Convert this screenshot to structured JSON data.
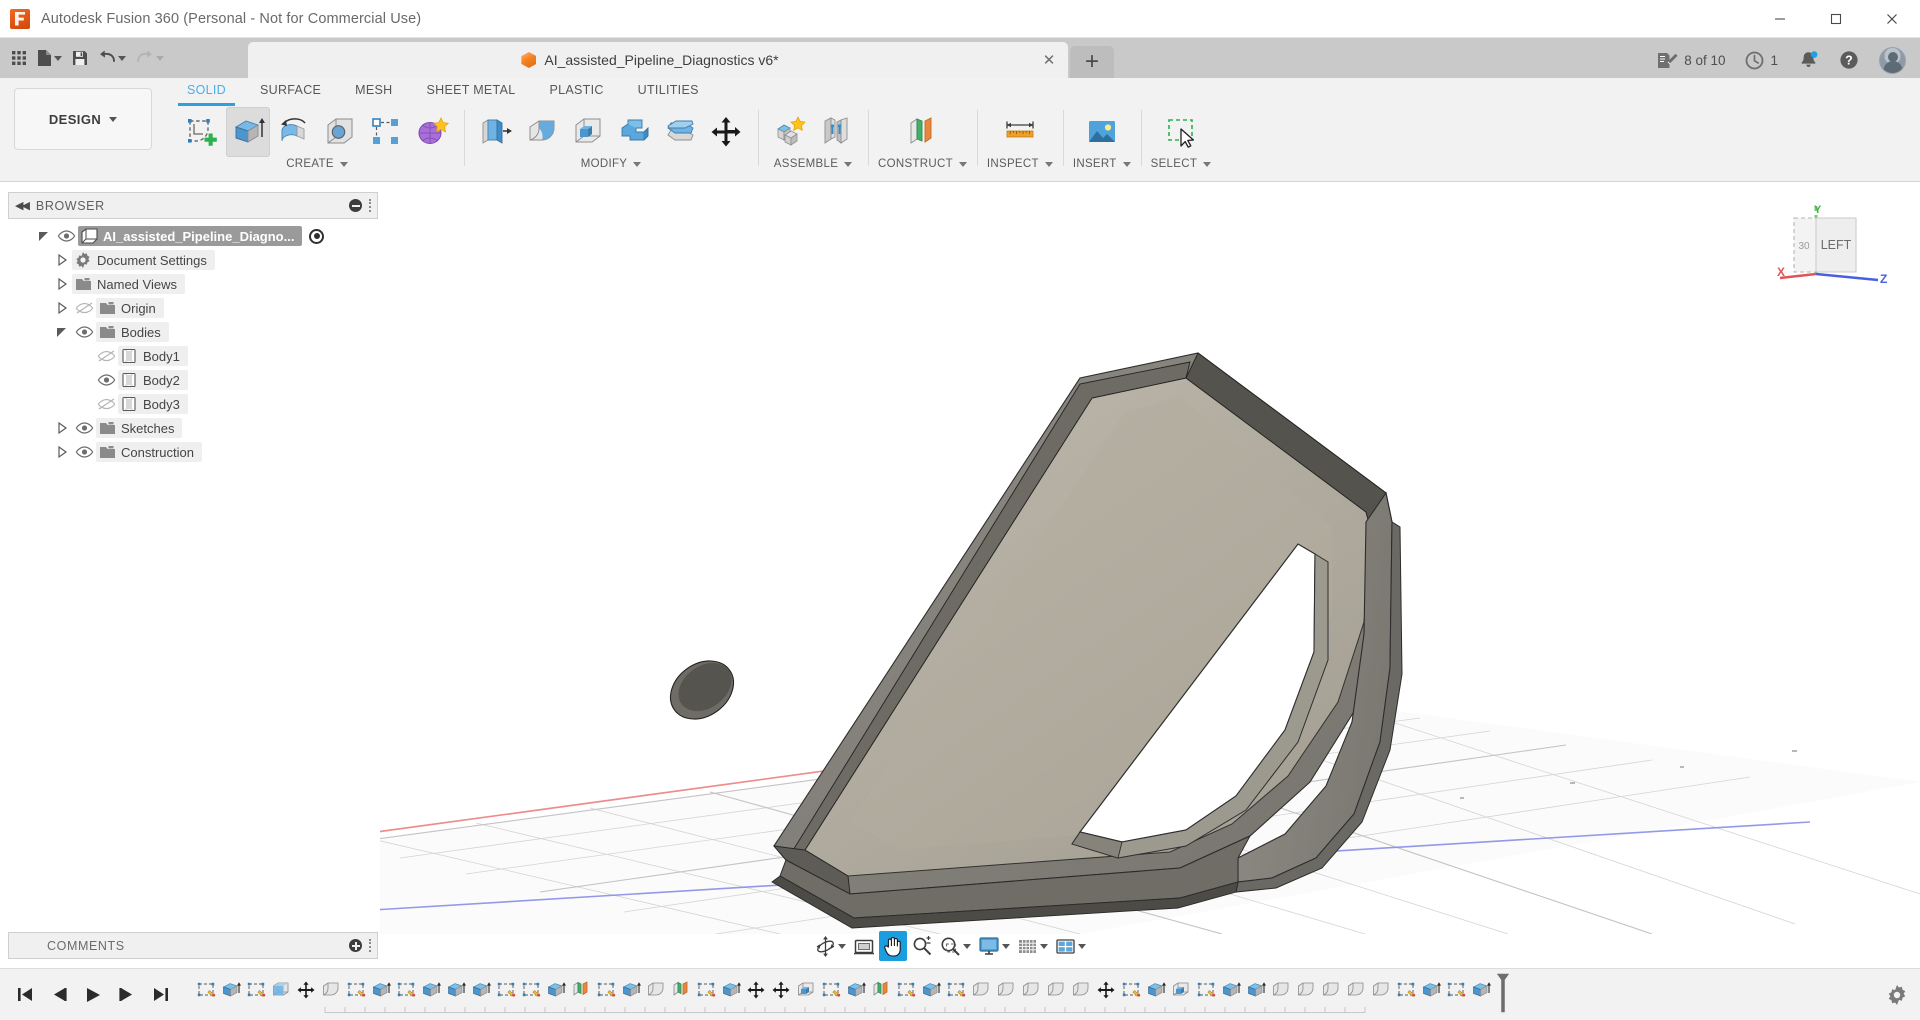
{
  "window": {
    "title": "Autodesk Fusion 360 (Personal - Not for Commercial Use)",
    "logo_icon": "fusion-logo-icon",
    "minimize_label": "–",
    "maximize_label": "❐",
    "close_label": "✕"
  },
  "quick_access": [
    {
      "name": "app-grid-button",
      "icon": "grid-apps-icon",
      "has_caret": false
    },
    {
      "name": "file-button",
      "icon": "file-icon",
      "has_caret": true
    },
    {
      "name": "save-button",
      "icon": "save-icon",
      "has_caret": false
    },
    {
      "name": "undo-button",
      "icon": "undo-icon",
      "has_caret": true
    },
    {
      "name": "redo-button",
      "icon": "redo-icon",
      "has_caret": true,
      "disabled": true
    }
  ],
  "document_tab": {
    "title": "AI_assisted_Pipeline_Diagnostics v6*",
    "icon": "orange-cube-icon",
    "close_label": "✕",
    "new_tab_label": "+"
  },
  "tab_right": {
    "jobs_label": "8 of 10",
    "jobs_icon": "job-status-icon",
    "history_label": "1",
    "history_icon": "clock-icon",
    "notifications_icon": "bell-icon",
    "help_icon": "help-icon",
    "account_icon": "user-avatar-icon"
  },
  "workspace": {
    "label": "DESIGN",
    "caret": "▾"
  },
  "ribbon_tabs": [
    {
      "label": "SOLID",
      "active": true
    },
    {
      "label": "SURFACE",
      "active": false
    },
    {
      "label": "MESH",
      "active": false
    },
    {
      "label": "SHEET METAL",
      "active": false
    },
    {
      "label": "PLASTIC",
      "active": false
    },
    {
      "label": "UTILITIES",
      "active": false
    }
  ],
  "ribbon_panels": [
    {
      "label": "CREATE",
      "has_caret": true,
      "buttons": [
        {
          "name": "create-sketch-button",
          "icon": "create-sketch-icon",
          "selected": false
        },
        {
          "name": "extrude-button",
          "icon": "extrude-icon",
          "selected": true
        },
        {
          "name": "revolve-button",
          "icon": "revolve-icon",
          "selected": false
        },
        {
          "name": "hole-button",
          "icon": "hole-icon",
          "selected": false
        },
        {
          "name": "rectangular-pattern-button",
          "icon": "pattern-icon",
          "selected": false
        },
        {
          "name": "form-button",
          "icon": "form-sculpt-icon",
          "selected": false
        }
      ]
    },
    {
      "label": "MODIFY",
      "has_caret": true,
      "buttons": [
        {
          "name": "press-pull-button",
          "icon": "press-pull-icon",
          "selected": false
        },
        {
          "name": "fillet-button",
          "icon": "fillet-icon",
          "selected": false
        },
        {
          "name": "shell-button",
          "icon": "shell-icon",
          "selected": false
        },
        {
          "name": "combine-button",
          "icon": "combine-icon",
          "selected": false
        },
        {
          "name": "split-body-button",
          "icon": "split-body-icon",
          "selected": false
        },
        {
          "name": "move-copy-button",
          "icon": "move-copy-icon",
          "selected": false
        }
      ]
    },
    {
      "label": "ASSEMBLE",
      "has_caret": true,
      "buttons": [
        {
          "name": "new-component-button",
          "icon": "new-component-icon",
          "selected": false
        },
        {
          "name": "joint-button",
          "icon": "joint-icon",
          "selected": false
        }
      ]
    },
    {
      "label": "CONSTRUCT",
      "has_caret": true,
      "buttons": [
        {
          "name": "offset-plane-button",
          "icon": "offset-plane-icon",
          "selected": false
        }
      ]
    },
    {
      "label": "INSPECT",
      "has_caret": true,
      "buttons": [
        {
          "name": "measure-button",
          "icon": "measure-ruler-icon",
          "selected": false
        }
      ]
    },
    {
      "label": "INSERT",
      "has_caret": true,
      "buttons": [
        {
          "name": "insert-mcmaster-button",
          "icon": "insert-image-icon",
          "selected": false
        }
      ]
    },
    {
      "label": "SELECT",
      "has_caret": true,
      "buttons": [
        {
          "name": "select-button",
          "icon": "select-marquee-icon",
          "selected": false
        }
      ]
    }
  ],
  "browser": {
    "title": "BROWSER",
    "collapse_icon": "collapse-left-icon",
    "minus-icon": "panel-minus-icon",
    "grip_icon": "panel-grip-icon",
    "tree": [
      {
        "label": "AI_assisted_Pipeline_Diagno...",
        "icon": "component-icon",
        "indent": 0,
        "twist": "open",
        "eye": "visible",
        "selected": true,
        "radio": true
      },
      {
        "label": "Document Settings",
        "icon": "gear-icon",
        "indent": 1,
        "twist": "closed",
        "eye": "none",
        "selected": false,
        "radio": false
      },
      {
        "label": "Named Views",
        "icon": "folder-icon",
        "indent": 1,
        "twist": "closed",
        "eye": "none",
        "selected": false,
        "radio": false
      },
      {
        "label": "Origin",
        "icon": "folder-icon",
        "indent": 1,
        "twist": "closed",
        "eye": "hidden",
        "selected": false,
        "radio": false
      },
      {
        "label": "Bodies",
        "icon": "folder-icon",
        "indent": 1,
        "twist": "open",
        "eye": "visible",
        "selected": false,
        "radio": false
      },
      {
        "label": "Body1",
        "icon": "body-icon",
        "indent": 2,
        "twist": "none",
        "eye": "hidden",
        "selected": false,
        "radio": false
      },
      {
        "label": "Body2",
        "icon": "body-icon",
        "indent": 2,
        "twist": "none",
        "eye": "visible",
        "selected": false,
        "radio": false
      },
      {
        "label": "Body3",
        "icon": "body-icon",
        "indent": 2,
        "twist": "none",
        "eye": "hidden",
        "selected": false,
        "radio": false
      },
      {
        "label": "Sketches",
        "icon": "folder-icon",
        "indent": 1,
        "twist": "closed",
        "eye": "visible",
        "selected": false,
        "radio": false
      },
      {
        "label": "Construction",
        "icon": "folder-icon",
        "indent": 1,
        "twist": "closed",
        "eye": "visible",
        "selected": false,
        "radio": false
      }
    ]
  },
  "viewcube": {
    "face_label": "LEFT",
    "side_label": "30",
    "axis_x": "X",
    "axis_y": "Y",
    "axis_z": "Z",
    "color_x": "#e05555",
    "color_y": "#4caf50",
    "color_z": "#4a5fe0"
  },
  "model": {
    "face_light": "#b9b4a6",
    "face_mid": "#8f8d85",
    "face_dark": "#6e6c66",
    "edge": "#2b2b2b",
    "grid_line": "#cfcfcf",
    "axis_x_color": "#e06666",
    "axis_z_color": "#6a73dd"
  },
  "comments": {
    "title": "COMMENTS",
    "add_icon": "panel-plus-icon",
    "grip_icon": "panel-grip-icon"
  },
  "navbar": [
    {
      "name": "orbit-button",
      "icon": "orbit-icon",
      "has_caret": true,
      "active": false
    },
    {
      "name": "look-at-button",
      "icon": "look-at-icon",
      "has_caret": false,
      "active": false
    },
    {
      "name": "pan-button",
      "icon": "pan-hand-icon",
      "has_caret": false,
      "active": true
    },
    {
      "name": "zoom-button",
      "icon": "zoom-icon",
      "has_caret": false,
      "active": false
    },
    {
      "name": "fit-button",
      "icon": "zoom-window-icon",
      "has_caret": true,
      "active": false
    },
    {
      "name": "display-settings-button",
      "icon": "display-monitor-icon",
      "has_caret": true,
      "active": false
    },
    {
      "name": "grid-snaps-button",
      "icon": "grid-icon",
      "has_caret": true,
      "active": false
    },
    {
      "name": "viewports-button",
      "icon": "viewports-icon",
      "has_caret": true,
      "active": false
    }
  ],
  "timeline": {
    "controls": [
      {
        "name": "go-to-beginning-button",
        "icon": "skip-start-icon"
      },
      {
        "name": "step-back-button",
        "icon": "step-back-icon"
      },
      {
        "name": "play-button",
        "icon": "play-icon"
      },
      {
        "name": "step-forward-button",
        "icon": "step-forward-icon"
      },
      {
        "name": "go-to-end-button",
        "icon": "skip-end-icon"
      }
    ],
    "settings_icon": "timeline-settings-gear-icon",
    "playhead_icon": "timeline-playhead-icon",
    "features": [
      "sketch",
      "extrude",
      "sketch",
      "shell",
      "move",
      "fillet",
      "sketch",
      "extrude",
      "sketch",
      "extrude",
      "extrude",
      "extrude",
      "sketch",
      "sketch",
      "extrude",
      "plane",
      "sketch",
      "extrude",
      "fillet",
      "plane",
      "sketch",
      "extrude",
      "move",
      "move",
      "shell-face",
      "sketch",
      "extrude",
      "plane",
      "sketch",
      "extrude",
      "sketch",
      "fillet",
      "fillet",
      "fillet",
      "fillet",
      "fillet",
      "move",
      "sketch",
      "extrude",
      "shell-face",
      "sketch",
      "extrude",
      "extrude",
      "fillet",
      "fillet",
      "fillet",
      "fillet",
      "fillet",
      "sketch",
      "extrude",
      "sketch",
      "extrude"
    ]
  }
}
